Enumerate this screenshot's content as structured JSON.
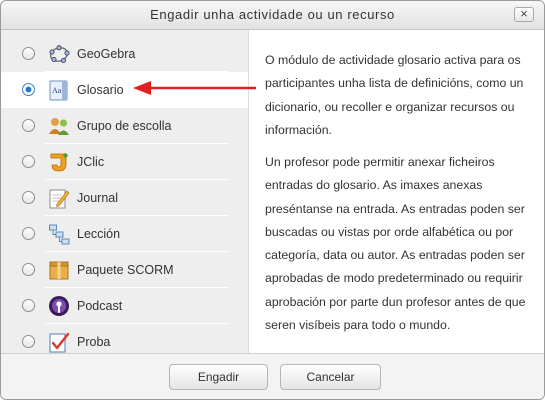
{
  "dialog": {
    "title": "Engadir unha actividade ou un recurso",
    "close_label": "×"
  },
  "options": [
    {
      "label": "GeoGebra",
      "icon": "geogebra-icon",
      "selected": false
    },
    {
      "label": "Glosario",
      "icon": "glossary-icon",
      "selected": true
    },
    {
      "label": "Grupo de escolla",
      "icon": "group-choice-icon",
      "selected": false
    },
    {
      "label": "JClic",
      "icon": "jclic-icon",
      "selected": false
    },
    {
      "label": "Journal",
      "icon": "journal-icon",
      "selected": false
    },
    {
      "label": "Lección",
      "icon": "lesson-icon",
      "selected": false
    },
    {
      "label": "Paquete SCORM",
      "icon": "scorm-package-icon",
      "selected": false
    },
    {
      "label": "Podcast",
      "icon": "podcast-icon",
      "selected": false
    },
    {
      "label": "Proba",
      "icon": "quiz-icon",
      "selected": false
    }
  ],
  "description": {
    "paragraphs": [
      "O módulo de actividade glosario activa para os participantes unha lista de definicións, como un dicionario, ou recoller e organizar recursos ou información.",
      "Un profesor pode permitir anexar ficheiros entradas do glosario. As imaxes anexas preséntanse na entrada. As entradas poden ser buscadas ou vistas por orde alfabética ou por categoría, data ou autor. As entradas poden ser aprobadas de modo predeterminado ou requirir aprobación por parte dun profesor antes de que seren visíbeis para todo o mundo."
    ]
  },
  "buttons": {
    "add": "Engadir",
    "cancel": "Cancelar"
  },
  "colors": {
    "annotation_arrow": "#e02020",
    "radio_selected": "#2a73c8"
  }
}
